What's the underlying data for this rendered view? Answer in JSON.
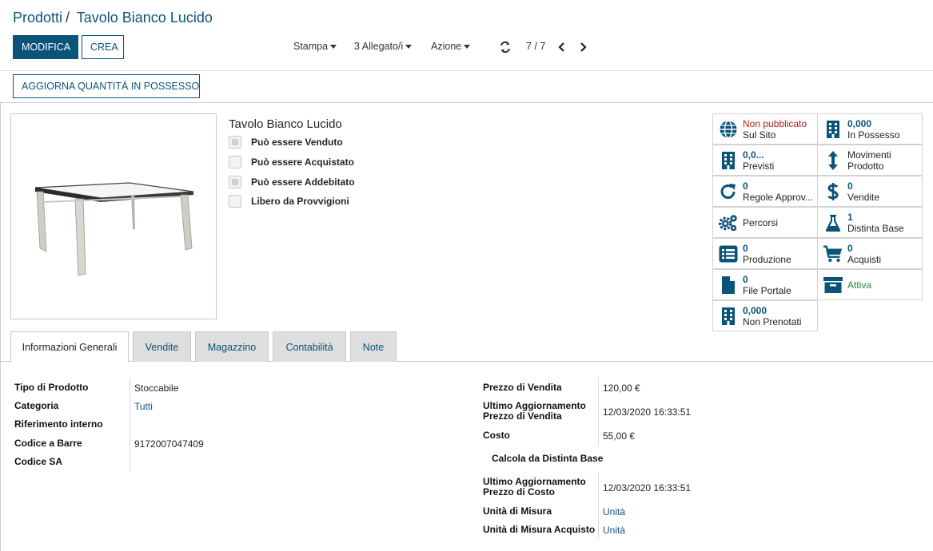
{
  "breadcrumb": {
    "parent": "Prodotti",
    "separator": "/",
    "current": "Tavolo Bianco Lucido"
  },
  "buttons": {
    "edit": "MODIFICA",
    "create": "CREA",
    "update_qty": "AGGIORNA QUANTITÀ IN POSSESSO"
  },
  "toolbar": {
    "print": "Stampa",
    "attachments": "3 Allegato/i",
    "action": "Azione",
    "pager": "7 / 7"
  },
  "product": {
    "name": "Tavolo Bianco Lucido",
    "flags": [
      {
        "label": "Può essere Venduto",
        "state": "indeterminate"
      },
      {
        "label": "Può essere Acquistato",
        "state": "unchecked"
      },
      {
        "label": "Può essere Addebitato",
        "state": "indeterminate"
      },
      {
        "label": "Libero da Provvigioni",
        "state": "unchecked"
      }
    ]
  },
  "smart_buttons": [
    {
      "icon": "globe-icon",
      "value": "Non pubblicato",
      "label": "Sul Sito",
      "value_color": "#b42323"
    },
    {
      "icon": "building-icon",
      "value": "0,000",
      "label": "In Possesso"
    },
    {
      "icon": "building-icon",
      "value": "0,0...",
      "label": "Previsti"
    },
    {
      "icon": "arrows-vertical-icon",
      "value": "",
      "label1": "Movimenti",
      "label": "Prodotto"
    },
    {
      "icon": "refresh-icon",
      "value": "0",
      "label": "Regole Approv..."
    },
    {
      "icon": "dollar-icon",
      "value": "0",
      "label": "Vendite"
    },
    {
      "icon": "gears-icon",
      "value": "",
      "label": "Percorsi"
    },
    {
      "icon": "flask-icon",
      "value": "1",
      "label": "Distinta Base"
    },
    {
      "icon": "list-icon",
      "value": "0",
      "label": "Produzione"
    },
    {
      "icon": "cart-icon",
      "value": "0",
      "label": "Acquisti"
    },
    {
      "icon": "file-icon",
      "value": "0",
      "label": "File Portale"
    },
    {
      "icon": "archive-icon",
      "value": "",
      "label": "Attiva",
      "value_color": "#2e7d32"
    },
    {
      "icon": "building-icon",
      "value": "0,000",
      "label": "Non Prenotati"
    }
  ],
  "tabs": [
    {
      "label": "Informazioni Generali",
      "active": true
    },
    {
      "label": "Vendite"
    },
    {
      "label": "Magazzino"
    },
    {
      "label": "Contabilità"
    },
    {
      "label": "Note"
    }
  ],
  "left_fields": [
    {
      "label": "Tipo di Prodotto",
      "value": "Stoccabile"
    },
    {
      "label": "Categoria",
      "value": "Tutti"
    },
    {
      "label": "Riferimento interno",
      "value": ""
    },
    {
      "label": "Codice a Barre",
      "value": "9172007047409"
    },
    {
      "label": "Codice SA",
      "value": ""
    }
  ],
  "right_fields": {
    "sale_price": {
      "label": "Prezzo di Vendita",
      "value": "120,00 €"
    },
    "sale_price_update": {
      "label1": "Ultimo Aggiornamento",
      "label2": "Prezzo di Vendita",
      "value": "12/03/2020 16:33:51"
    },
    "cost": {
      "label": "Costo",
      "value": "55,00 €"
    },
    "bom_link": "Calcola da Distinta Base",
    "cost_update": {
      "label1": "Ultimo Aggiornamento",
      "label2": "Prezzo di Costo",
      "value": "12/03/2020 16:33:51"
    },
    "uom": {
      "label": "Unità di Misura",
      "value": "Unità"
    },
    "uom_po": {
      "label": "Unità di Misura Acquisto",
      "value": "Unità"
    }
  },
  "colors": {
    "brand": "#0b5479",
    "unpublished": "#b42323",
    "active": "#2e7d32"
  }
}
